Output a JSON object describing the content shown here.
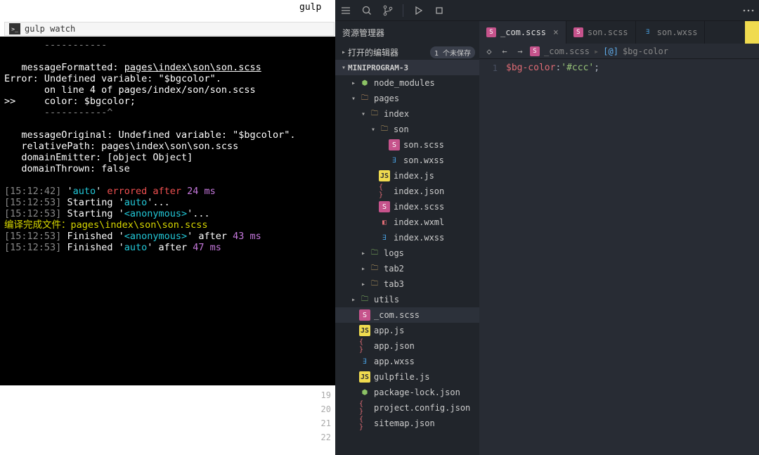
{
  "terminal": {
    "gutter_title": "gulp",
    "title": "gulp watch",
    "lines": {
      "dashes": "       -----------",
      "msgFmt_label": "   messageFormatted: ",
      "msgFmt_path": "pages\\index\\son\\son.scss",
      "err1": "Error: Undefined variable: \"$bgcolor\".",
      "err2": "       on line 4 of pages/index/son/son.scss",
      "err3": ">>     color: $bgcolor;",
      "dashes2": "       -----------^",
      "msgOrig": "   messageOriginal: Undefined variable: \"$bgcolor\".",
      "relPath": "   relativePath: pages\\index\\son\\son.scss",
      "domEmit": "   domainEmitter: [object Object]",
      "domThrown": "   domainThrown: false",
      "t1_time": "15:12:42",
      "t1_a": "'",
      "t1_b": "auto",
      "t1_c": "' ",
      "t1_d": "errored after",
      "t1_e": " 24 ms",
      "t2_time": "15:12:53",
      "t2_text": "Starting '",
      "t2_task": "auto",
      "t2_end": "'...",
      "t3_time": "15:12:53",
      "t3_text": "Starting '",
      "t3_task": "<anonymous>",
      "t3_end": "'...",
      "compile": "编译完成文件：pages\\index\\son\\son.scss",
      "t4_time": "15:12:53",
      "t4_a": "Finished '",
      "t4_task": "<anonymous>",
      "t4_b": "' after ",
      "t4_ms": "43 ms",
      "t5_time": "15:12:53",
      "t5_a": "Finished '",
      "t5_task": "auto",
      "t5_b": "' after ",
      "t5_ms": "47 ms"
    }
  },
  "gutter_lines": [
    "19",
    "20",
    "21",
    "22"
  ],
  "editor": {
    "sidebar_title": "资源管理器",
    "open_editors_label": "打开的编辑器",
    "open_editors_badge": "1 个未保存",
    "project_name": "MINIPROGRAM-3",
    "tree": {
      "node_modules": "node_modules",
      "pages": "pages",
      "index": "index",
      "son": "son",
      "son_scss": "son.scss",
      "son_wxss": "son.wxss",
      "index_js": "index.js",
      "index_json": "index.json",
      "index_scss": "index.scss",
      "index_wxml": "index.wxml",
      "index_wxss": "index.wxss",
      "logs": "logs",
      "tab2": "tab2",
      "tab3": "tab3",
      "utils": "utils",
      "com_scss": "_com.scss",
      "app_js": "app.js",
      "app_json": "app.json",
      "app_wxss": "app.wxss",
      "gulpfile_js": "gulpfile.js",
      "package_lock": "package-lock.json",
      "project_config": "project.config.json",
      "sitemap": "sitemap.json"
    },
    "tabs": {
      "com_scss": "_com.scss",
      "son_scss": "son.scss",
      "son_wxss": "son.wxss"
    },
    "breadcrumb": {
      "file": "_com.scss",
      "symbol": "$bg-color"
    },
    "code": {
      "line_no": "1",
      "var": "$bg-color",
      "colon": ":",
      "value": "'#ccc'",
      "semi": ";"
    }
  }
}
